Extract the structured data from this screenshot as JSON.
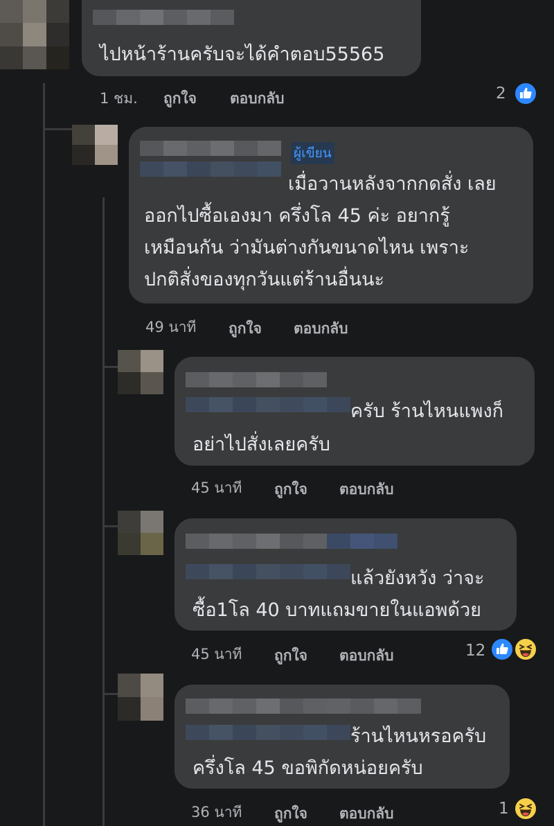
{
  "comments": [
    {
      "text_lines": [
        "ไปหน้าร้านครับจะได้คำตอบ55565"
      ],
      "time": "1 ชม.",
      "like_label": "ถูกใจ",
      "reply_label": "ตอบกลับ",
      "reaction_count": "2",
      "reactions": [
        "like-icon"
      ]
    }
  ],
  "replies": [
    {
      "author_badge": "ผู้เขียน",
      "text_lines": [
        "เมื่อวานหลังจากกดสั่ง เลย",
        "ออกไปซื้อเองมา ครึ่งโล 45 ค่ะ อยากรู้",
        "เหมือนกัน ว่ามันต่างกันขนาดไหน เพราะ",
        "ปกติสั่งของทุกวันแต่ร้านอื่นนะ"
      ],
      "time": "49 นาที",
      "like_label": "ถูกใจ",
      "reply_label": "ตอบกลับ"
    },
    {
      "text_lines": [
        "ครับ  ร้านไหนแพงก็",
        "อย่าไปสั่งเลยครับ"
      ],
      "time": "45 นาที",
      "like_label": "ถูกใจ",
      "reply_label": "ตอบกลับ"
    },
    {
      "text_lines": [
        "แล้วยังหวัง ว่าจะ",
        "ซื้อ1โล 40 บาทแถมขายในแอพด้วย"
      ],
      "time": "45 นาที",
      "like_label": "ถูกใจ",
      "reply_label": "ตอบกลับ",
      "reaction_count": "12",
      "reactions": [
        "like-icon",
        "haha-icon"
      ]
    },
    {
      "text_lines": [
        "ร้านไหนหรอครับ",
        "ครึ่งโล 45 ขอพิกัดหน่อยครับ"
      ],
      "time": "36 นาที",
      "like_label": "ถูกใจ",
      "reply_label": "ตอบกลับ",
      "reaction_count": "1",
      "reactions": [
        "haha-icon"
      ]
    }
  ],
  "colors": {
    "background": "#18191a",
    "bubble": "#3a3b3c",
    "text": "#e4e6eb",
    "meta_text": "#b0b3b8",
    "author_badge": "#4599ff",
    "like_blue": "#2d88ff",
    "haha_yellow": "#f7d04a"
  }
}
